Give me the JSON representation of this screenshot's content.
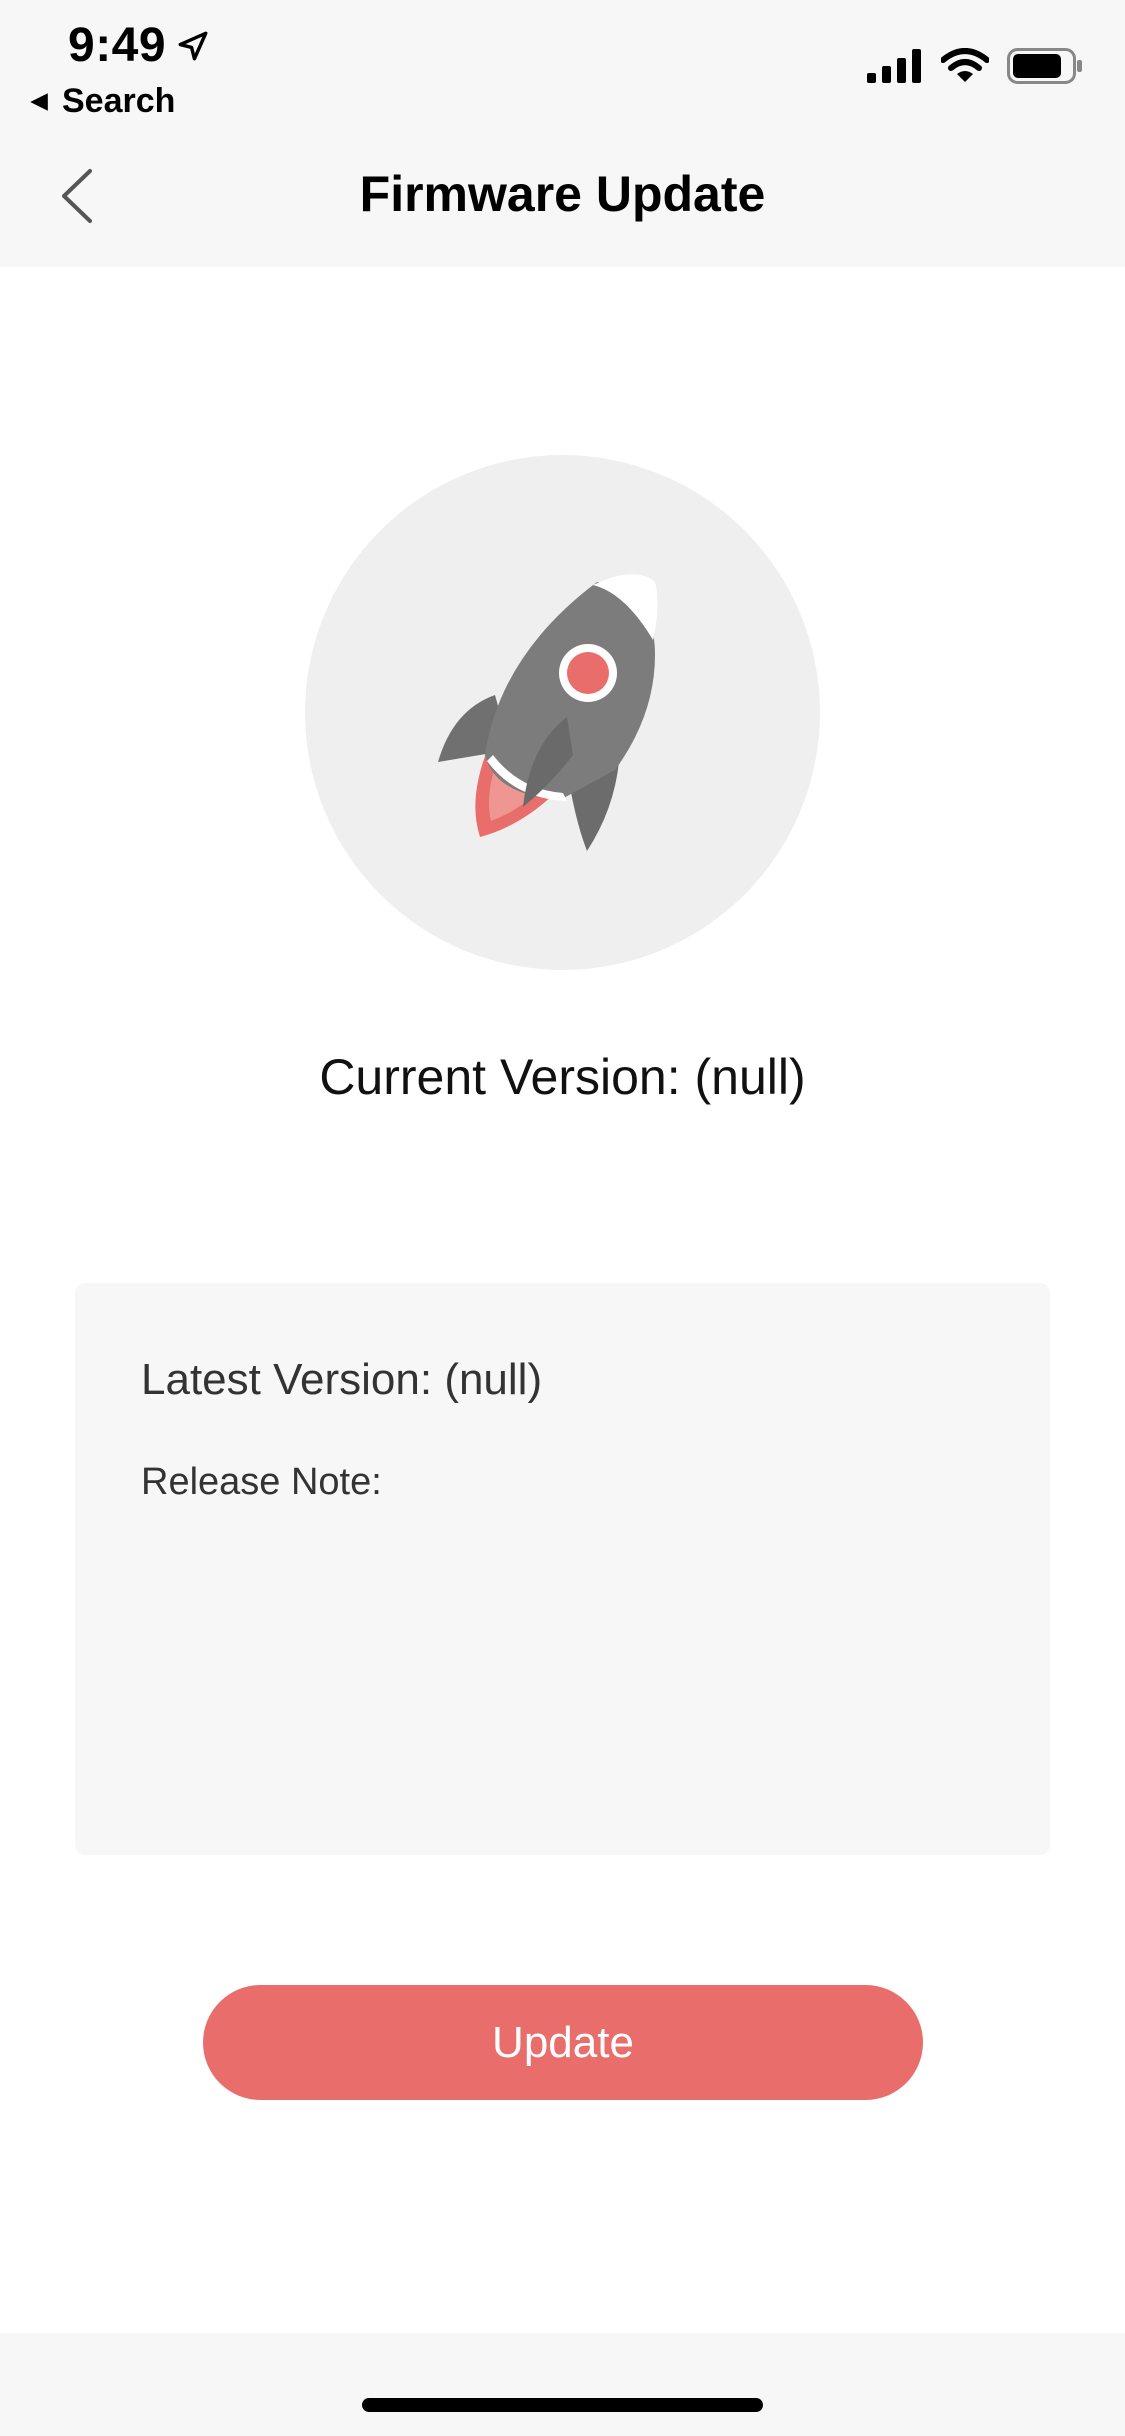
{
  "status_bar": {
    "time": "9:49",
    "back_to_app": "Search",
    "icons": [
      "location-arrow-icon",
      "signal-icon",
      "wifi-icon",
      "battery-icon"
    ]
  },
  "nav": {
    "title": "Firmware Update",
    "back_icon": "chevron-left-icon"
  },
  "hero": {
    "icon": "rocket-icon",
    "current_version_label": "Current Version:",
    "current_version_value": "(null)"
  },
  "info": {
    "latest_version_label": "Latest Version:",
    "latest_version_value": "(null)",
    "release_note_label": "Release Note:",
    "release_note_text": ""
  },
  "actions": {
    "update_label": "Update"
  },
  "colors": {
    "accent": "#e86d6b",
    "header_background": "#f7f7f7",
    "card_background": "#f7f7f7",
    "hero_circle": "#efefef",
    "rocket_body": "#7a7a7a"
  }
}
